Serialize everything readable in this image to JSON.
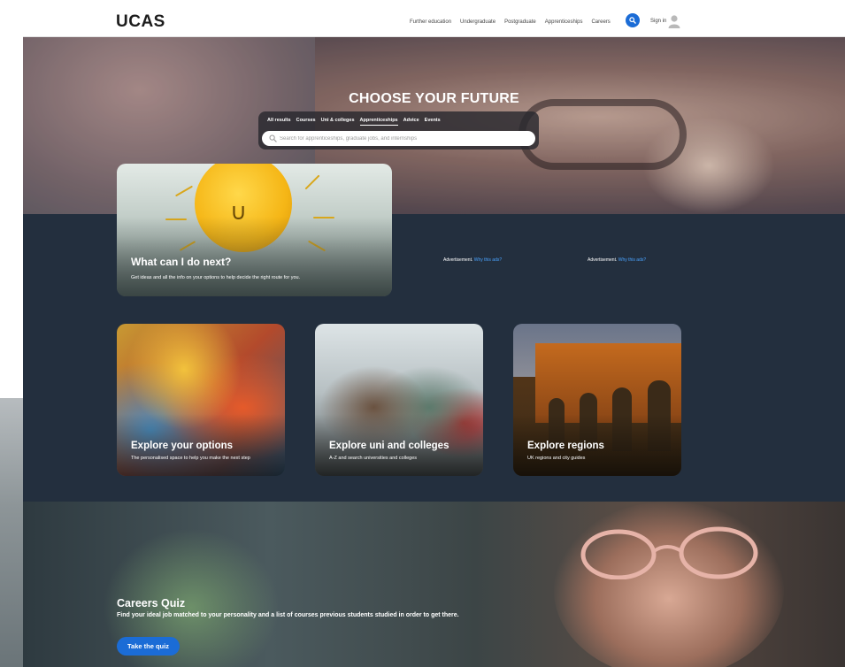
{
  "header": {
    "logo": "UCAS",
    "nav": [
      "Further education",
      "Undergraduate",
      "Postgraduate",
      "Apprenticeships",
      "Careers"
    ],
    "signin": "Sign in"
  },
  "hero": {
    "title": "CHOOSE YOUR FUTURE",
    "tabs": [
      "All results",
      "Courses",
      "Uni & colleges",
      "Apprenticeships",
      "Advice",
      "Events"
    ],
    "active_tab": "Apprenticeships",
    "search_placeholder": "Search for apprenticeships, graduate jobs, and internships"
  },
  "feature": {
    "title": "What can I do next?",
    "subtitle": "Get ideas and all the info on your options to help decide the right route for you."
  },
  "ads": [
    {
      "label": "Advertisement.",
      "link": "Why this ads?"
    },
    {
      "label": "Advertisement.",
      "link": "Why this ads?"
    }
  ],
  "cards": [
    {
      "title": "Explore your options",
      "subtitle": "The personalised space to help you make the next step"
    },
    {
      "title": "Explore uni and colleges",
      "subtitle": "A-Z and search universities and colleges"
    },
    {
      "title": "Explore regions",
      "subtitle": "UK regions and city guides"
    }
  ],
  "banner": {
    "title": "Careers Quiz",
    "subtitle": "Find your ideal job matched to your personality and a list of courses previous students studied in order to get there.",
    "button": "Take the quiz"
  },
  "colors": {
    "accent": "#1b6cd6",
    "dark_section": "#232f3e"
  }
}
